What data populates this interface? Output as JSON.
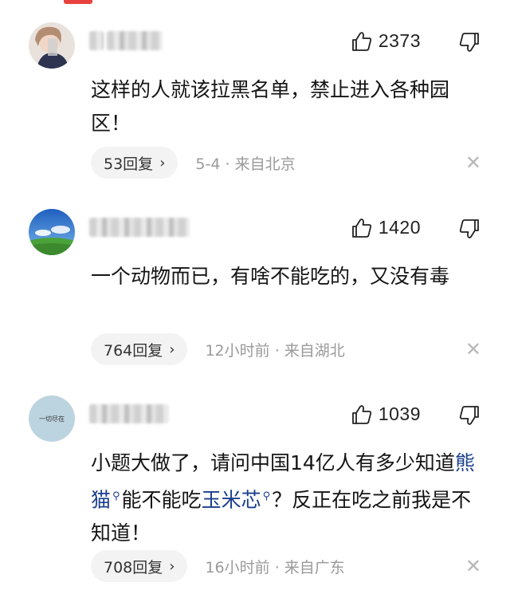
{
  "comments": [
    {
      "likes": "2373",
      "text": "这样的人就该拉黑名单，禁止进入各种园区！",
      "replies": "53回复",
      "date": "5-4",
      "location": "来自北京"
    },
    {
      "likes": "1420",
      "text": "一个动物而已，有啥不能吃的，又没有毒",
      "replies": "764回复",
      "date": "12小时前",
      "location": "来自湖北"
    },
    {
      "likes": "1039",
      "text_part1": "小题大做了，请问中国14亿人有多少知道",
      "link1": "熊猫",
      "text_part2": "能不能吃",
      "link2": "玉米芯",
      "text_part3": "？反正在吃之前我是不知道！",
      "avatar_text": "一切尽在",
      "replies": "708回复",
      "date": "16小时前",
      "location": "来自广东"
    }
  ],
  "icons": {
    "like": "thumbs-up-icon",
    "dislike": "thumbs-down-icon",
    "reply_chevron": "chevron-right-icon",
    "close": "close-icon",
    "search": "search-icon"
  },
  "separator": "·",
  "chevron_glyph": "›",
  "close_glyph": "✕",
  "colors": {
    "accent": "#e8413f",
    "link": "#1a3f8c",
    "meta": "#9a9a9a",
    "pill_bg": "#f3f3f3"
  }
}
